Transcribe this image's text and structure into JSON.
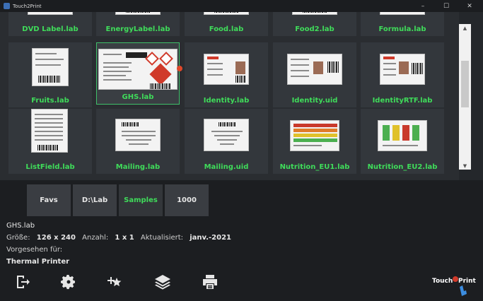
{
  "window": {
    "title": "Touch2Print",
    "min": "–",
    "max": "☐",
    "close": "✕"
  },
  "gallery": {
    "items": [
      {
        "label": "DVD Label.lab"
      },
      {
        "label": "EnergyLabel.lab"
      },
      {
        "label": "Food.lab"
      },
      {
        "label": "Food2.lab"
      },
      {
        "label": "Formula.lab"
      },
      {
        "label": "Fruits.lab"
      },
      {
        "label": "GHS.lab",
        "selected": true
      },
      {
        "label": "Identity.lab"
      },
      {
        "label": "Identity.uid"
      },
      {
        "label": "IdentityRTF.lab"
      },
      {
        "label": "ListField.lab"
      },
      {
        "label": "Mailing.lab"
      },
      {
        "label": "Mailing.uid"
      },
      {
        "label": "Nutrition_EU1.lab"
      },
      {
        "label": "Nutrition_EU2.lab"
      }
    ]
  },
  "tabs": [
    {
      "label": "Favs"
    },
    {
      "label": "D:\\Lab"
    },
    {
      "label": "Samples",
      "active": true
    },
    {
      "label": "1000"
    }
  ],
  "details": {
    "filename": "GHS.lab",
    "size_label": "Größe:",
    "size_value": "126 x 240",
    "count_label": "Anzahl:",
    "count_value": "1 x 1",
    "updated_label": "Aktualisiert:",
    "updated_value": "janv.-2021",
    "intended_label": "Vorgesehen für:",
    "printer": "Thermal Printer"
  },
  "toolbar": [
    "exit-icon",
    "settings-gear-icon",
    "favorite-star-icon",
    "layers-icon",
    "printer-icon"
  ],
  "logo": {
    "text1": "Touch",
    "text2": "Print"
  },
  "colors": {
    "accent_green": "#3fdc5a",
    "background": "#24272b",
    "selection_border": "#3fbf6a"
  }
}
